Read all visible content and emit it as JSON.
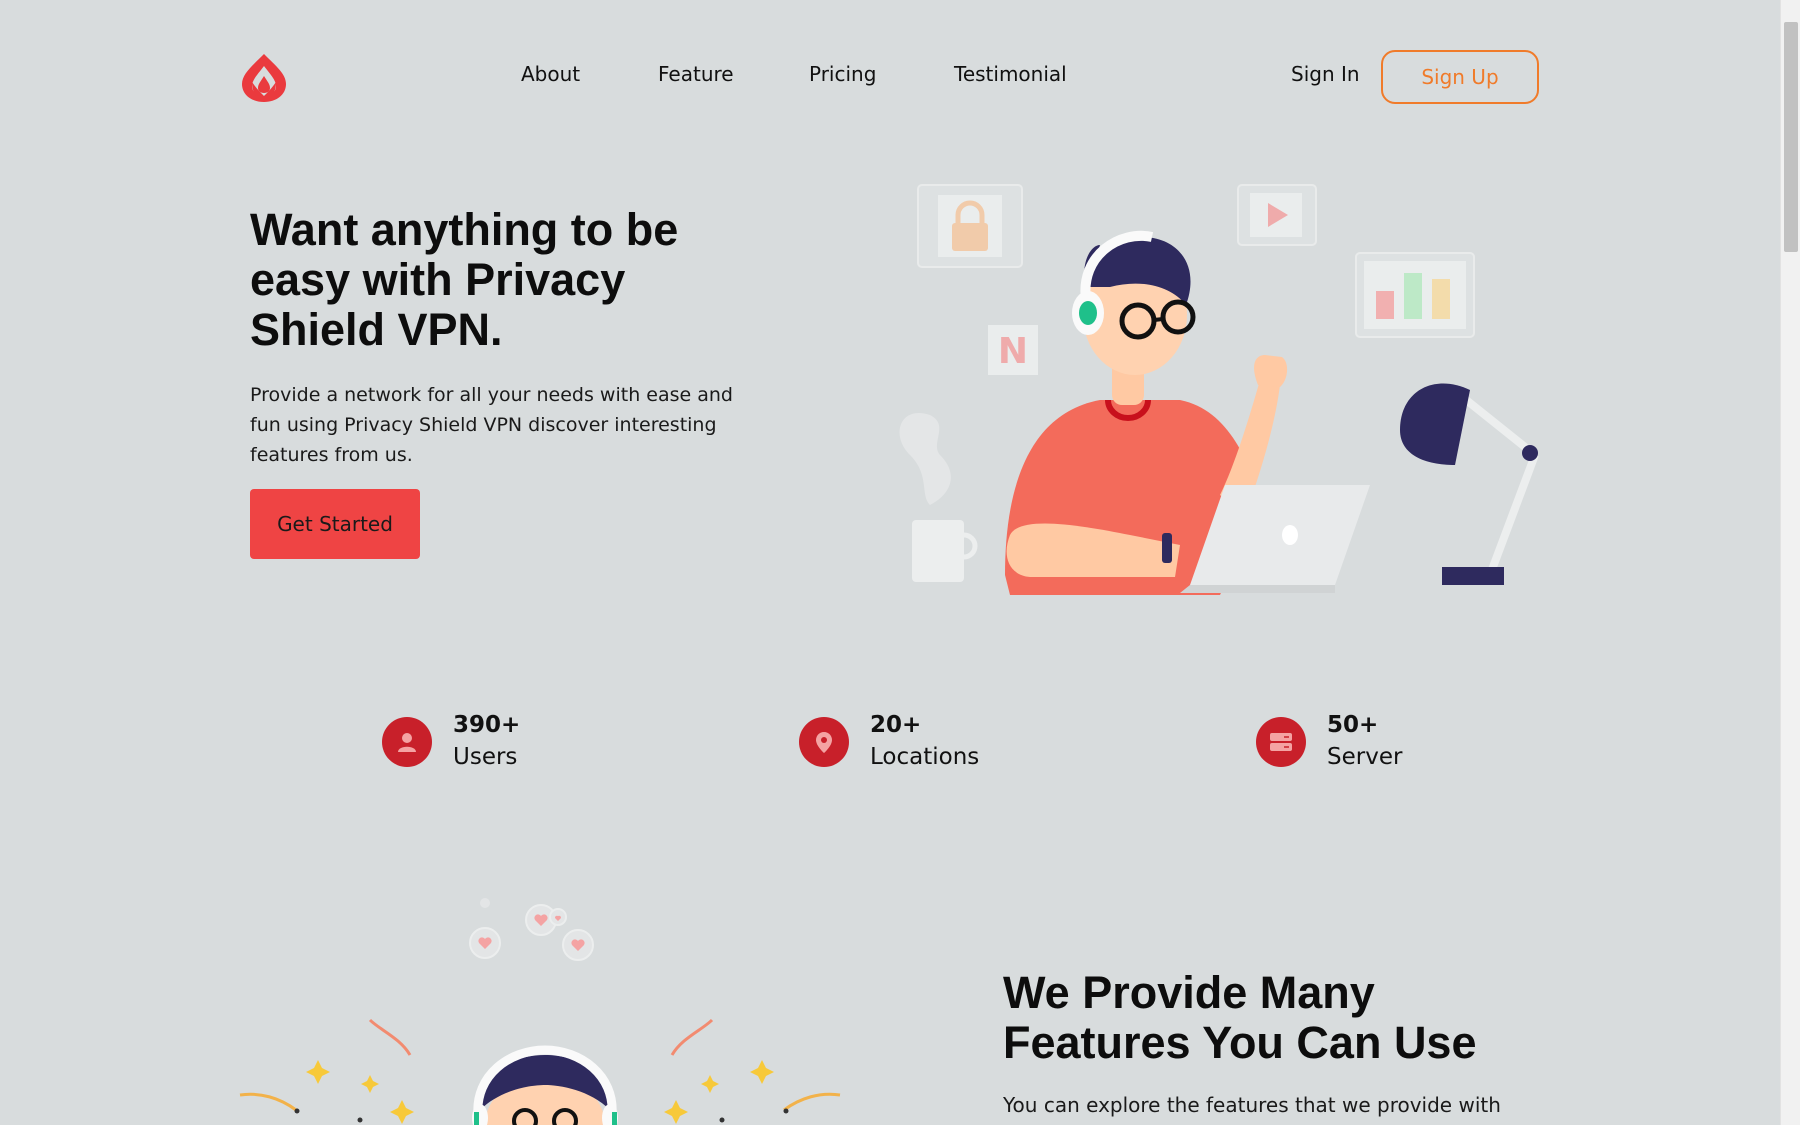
{
  "nav": {
    "links": [
      "About",
      "Feature",
      "Pricing",
      "Testimonial"
    ],
    "signin": "Sign In",
    "signup": "Sign Up"
  },
  "hero": {
    "title": "Want anything to be easy with Privacy Shield VPN.",
    "text": "Provide a network for all your needs with ease and fun using Privacy Shield VPN discover interesting features from us.",
    "cta": "Get Started"
  },
  "stats": [
    {
      "value": "390+",
      "label": "Users",
      "icon": "user-icon"
    },
    {
      "value": "20+",
      "label": "Locations",
      "icon": "location-pin-icon"
    },
    {
      "value": "50+",
      "label": "Server",
      "icon": "server-icon"
    }
  ],
  "features": {
    "title": "We Provide Many Features You Can Use",
    "text": "You can explore the features that we provide with"
  },
  "colors": {
    "background": "#d8dcdd",
    "accent_red": "#ef4444",
    "stat_icon_red": "#c8202a",
    "signup_orange": "#f07b2a"
  }
}
